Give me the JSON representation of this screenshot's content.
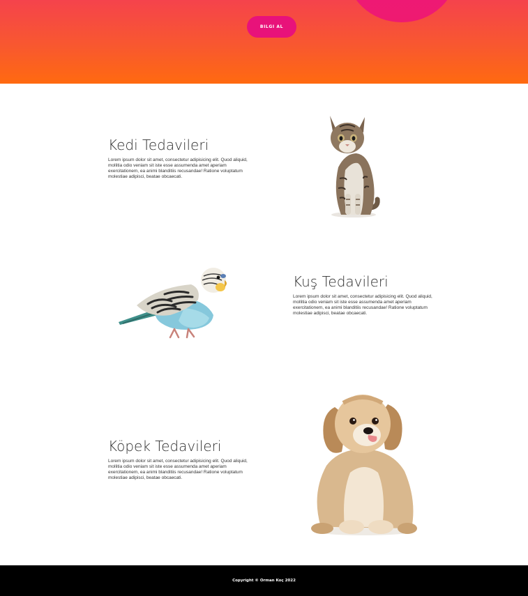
{
  "hero": {
    "cta_label": "BILGI AL",
    "colors": {
      "gradient_top": "#f5434c",
      "gradient_bottom": "#ff6a10",
      "accent": "#e8127a"
    }
  },
  "sections": [
    {
      "title": "Kedi Tedavileri",
      "body": "Lorem ipsum dolor sit amet, consectetur adipisicing elit. Quod aliquid, mollitia odio veniam sit iste esse assumenda amet aperiam exercitationem, ea animi blanditiis recusandae! Ratione voluptatum molestiae adipisci, beatae obcaecati.",
      "image": "cat-photo"
    },
    {
      "title": "Kuş Tedavileri",
      "body": "Lorem ipsum dolor sit amet, consectetur adipisicing elit. Quod aliquid, mollitia odio veniam sit iste esse assumenda amet aperiam exercitationem, ea animi blanditiis recusandae! Ratione voluptatum molestiae adipisci, beatae obcaecati.",
      "image": "budgie-photo"
    },
    {
      "title": "Köpek Tedavileri",
      "body": "Lorem ipsum dolor sit amet, consectetur adipisicing elit. Quod aliquid, mollitia odio veniam sit iste esse assumenda amet aperiam exercitationem, ea animi blanditiis recusandae! Ratione voluptatum molestiae adipisci, beatae obcaecati.",
      "image": "puppy-photo"
    }
  ],
  "footer": {
    "copyright": "Copyright © Orman Koç 2022"
  }
}
